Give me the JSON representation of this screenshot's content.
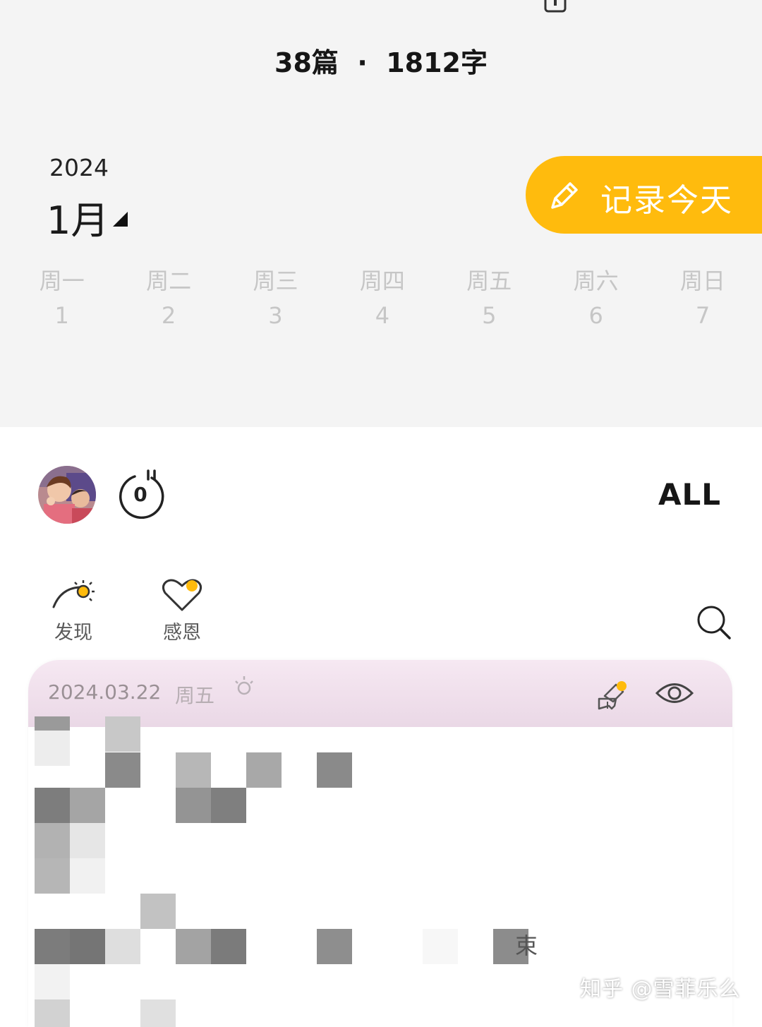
{
  "header": {
    "stats": "38篇  ·  1812字"
  },
  "calendar": {
    "year": "2024",
    "month": "1月",
    "record_label": "记录今天",
    "accent_color": "#ffbb0d",
    "days": [
      {
        "name": "周一",
        "date": "1"
      },
      {
        "name": "周二",
        "date": "2"
      },
      {
        "name": "周三",
        "date": "3"
      },
      {
        "name": "周四",
        "date": "4"
      },
      {
        "name": "周五",
        "date": "5"
      },
      {
        "name": "周六",
        "date": "6"
      },
      {
        "name": "周日",
        "date": "7"
      }
    ]
  },
  "toolbar": {
    "counter_value": "0",
    "filter_label": "ALL"
  },
  "nav": {
    "discover_label": "发现",
    "gratitude_label": "感恩"
  },
  "entry": {
    "date": "2024.03.22",
    "weekday": "周五",
    "visible_text": "束"
  },
  "watermark": "知乎 @雪菲乐么"
}
